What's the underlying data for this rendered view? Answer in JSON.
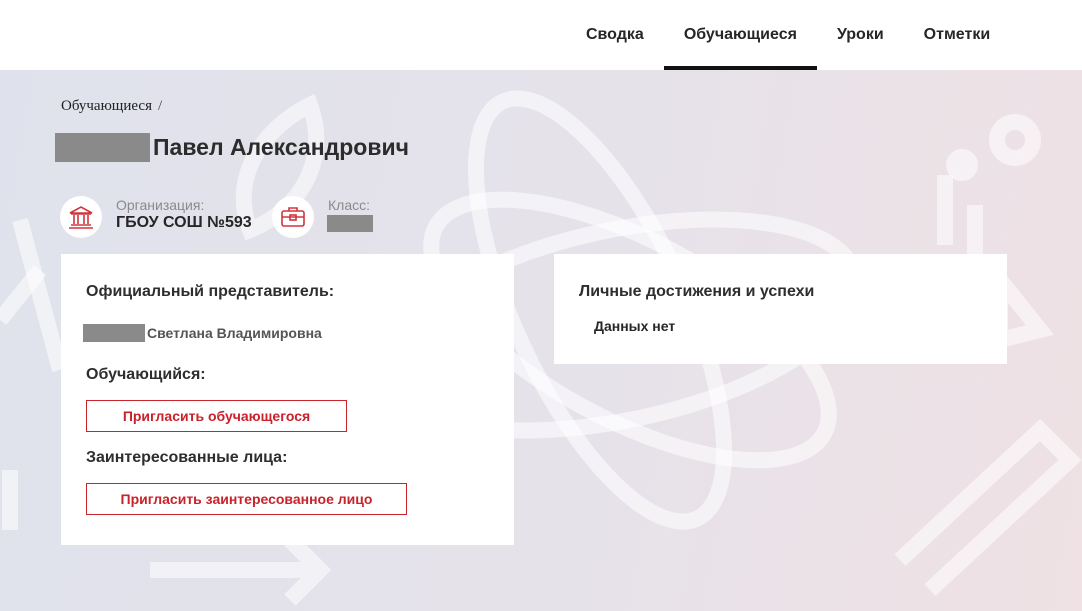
{
  "nav": {
    "tabs": [
      {
        "label": "Сводка",
        "active": false
      },
      {
        "label": "Обучающиеся",
        "active": true
      },
      {
        "label": "Уроки",
        "active": false
      },
      {
        "label": "Отметки",
        "active": false
      }
    ]
  },
  "breadcrumb": {
    "item": "Обучающиеся",
    "separator": "/"
  },
  "student": {
    "name_visible": "Павел Александрович"
  },
  "organization": {
    "label": "Организация:",
    "value": "ГБОУ СОШ №593"
  },
  "class": {
    "label": "Класс:"
  },
  "representative_card": {
    "title": "Официальный представитель:",
    "representative_name": "Светлана Владимировна",
    "student_title": "Обучающийся:",
    "invite_student_label": "Пригласить обучающегося",
    "interested_title": "Заинтересованные лица:",
    "invite_interested_label": "Пригласить заинтересованное лицо"
  },
  "achievements_card": {
    "title": "Личные достижения и успехи",
    "empty_text": "Данных нет"
  },
  "colors": {
    "accent": "#c8222a",
    "redaction": "#8a8a8a",
    "active_tab_underline": "#111111"
  },
  "icons": {
    "organization": "bank-icon",
    "class": "briefcase-icon"
  }
}
